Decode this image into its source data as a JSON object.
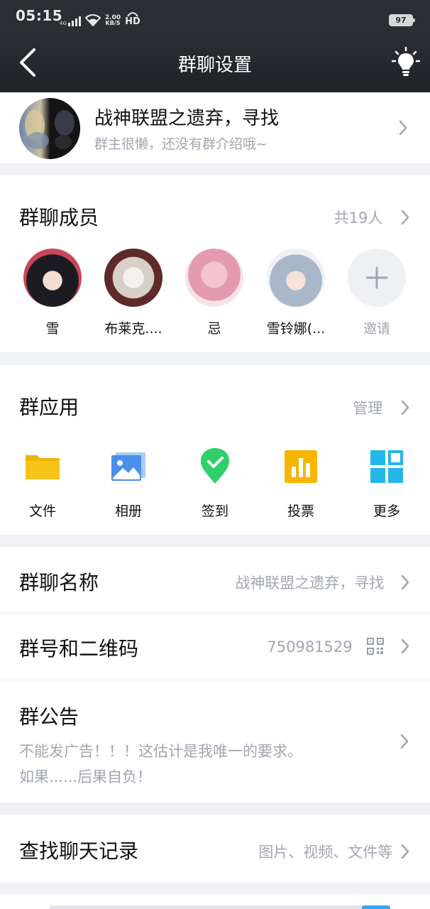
{
  "status_bar": {
    "time": "05:15",
    "network_type": "4G",
    "speed_value": "2.00",
    "speed_unit": "KB/S",
    "hd": "HD",
    "battery": "97"
  },
  "nav": {
    "title": "群聊设置"
  },
  "group": {
    "name": "战神联盟之遗弃，寻找",
    "intro": "群主很懒，还没有群介绍哦~"
  },
  "members": {
    "title": "群聊成员",
    "count": "共19人",
    "list": [
      {
        "name": "雪"
      },
      {
        "name": "布莱克...."
      },
      {
        "name": "忌"
      },
      {
        "name": "雪铃娜(..."
      }
    ],
    "invite_label": "邀请"
  },
  "apps": {
    "title": "群应用",
    "manage": "管理",
    "items": [
      {
        "label": "文件",
        "icon": "folder-icon",
        "color": "#f7c51a"
      },
      {
        "label": "相册",
        "icon": "album-icon",
        "color": "#4a8fea"
      },
      {
        "label": "签到",
        "icon": "checkin-icon",
        "color": "#2fcf6a"
      },
      {
        "label": "投票",
        "icon": "vote-icon",
        "color": "#f7b500"
      },
      {
        "label": "更多",
        "icon": "grid-icon",
        "color": "#24b6e6"
      }
    ]
  },
  "settings": {
    "group_name": {
      "label": "群聊名称",
      "value": "战神联盟之遗弃，寻找"
    },
    "group_id": {
      "label": "群号和二维码",
      "value": "750981529"
    },
    "announcement": {
      "label": "群公告",
      "line1": "不能发广告！！！这估计是我唯一的要求。",
      "line2": "如果......后果自负！"
    },
    "search": {
      "label": "查找聊天记录",
      "value": "图片、视频、文件等"
    }
  }
}
